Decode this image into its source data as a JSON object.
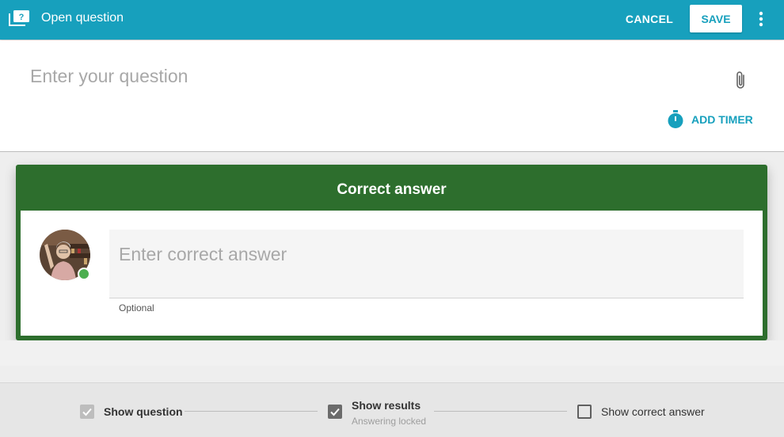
{
  "header": {
    "title": "Open question",
    "cancel_label": "CANCEL",
    "save_label": "SAVE",
    "icon": "question-slide-icon",
    "more_icon": "more-vert-icon",
    "color": "#17a0bd"
  },
  "question": {
    "placeholder": "Enter your question",
    "attach_icon": "paperclip-icon",
    "add_timer_label": "ADD TIMER",
    "timer_icon": "stopwatch-icon"
  },
  "answer_card": {
    "heading": "Correct answer",
    "placeholder": "Enter correct answer",
    "hint": "Optional",
    "color": "#2d6e2d",
    "avatar_status": "online"
  },
  "stepper": {
    "steps": [
      {
        "label": "Show question",
        "state": "checked-disabled"
      },
      {
        "label": "Show results",
        "sublabel": "Answering locked",
        "state": "checked"
      },
      {
        "label": "Show correct answer",
        "state": "unchecked"
      }
    ]
  }
}
